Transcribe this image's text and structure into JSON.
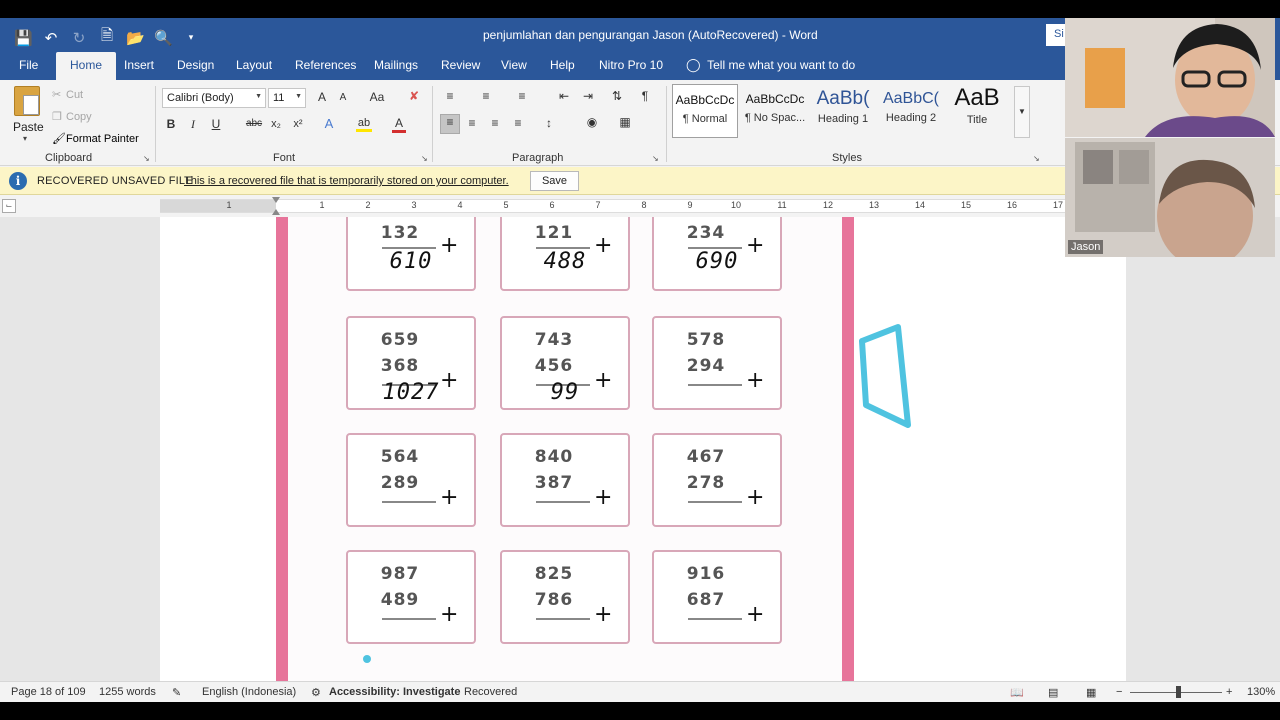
{
  "window": {
    "title": "penjumlahan dan pengurangan Jason (AutoRecovered)  -  Word",
    "signin_label": "Si"
  },
  "tabs": [
    {
      "label": "File"
    },
    {
      "label": "Home",
      "active": true
    },
    {
      "label": "Insert"
    },
    {
      "label": "Design"
    },
    {
      "label": "Layout"
    },
    {
      "label": "References"
    },
    {
      "label": "Mailings"
    },
    {
      "label": "Review"
    },
    {
      "label": "View"
    },
    {
      "label": "Help"
    },
    {
      "label": "Nitro Pro 10"
    }
  ],
  "tell_me": "Tell me what you want to do",
  "clipboard": {
    "paste": "Paste",
    "cut": "Cut",
    "copy": "Copy",
    "format_painter": "Format Painter",
    "group": "Clipboard"
  },
  "font": {
    "family": "Calibri (Body)",
    "size": "11",
    "group": "Font",
    "bold": "B",
    "italic": "I",
    "underline": "U",
    "strike": "abc",
    "subscript": "x₂",
    "superscript": "x²",
    "grow": "A",
    "shrink": "A",
    "change_case": "Aa",
    "effects": "A",
    "highlight": "ab",
    "color": "A"
  },
  "paragraph": {
    "group": "Paragraph"
  },
  "styles": {
    "group": "Styles",
    "items": [
      {
        "sample": "AaBbCcDc",
        "name": "¶ Normal",
        "selected": true
      },
      {
        "sample": "AaBbCcDc",
        "name": "¶ No Spac..."
      },
      {
        "sample": "AaBb(",
        "name": "Heading 1"
      },
      {
        "sample": "AaBbC(",
        "name": "Heading 2"
      },
      {
        "sample": "AaB",
        "name": "Title"
      }
    ]
  },
  "message_bar": {
    "title": "RECOVERED UNSAVED FILE",
    "text": "This is a recovered file that is temporarily stored on your computer.",
    "button": "Save"
  },
  "ruler": {
    "numbers_left": [
      "1"
    ],
    "numbers": [
      "1",
      "2",
      "3",
      "4",
      "5",
      "6",
      "7",
      "8",
      "9",
      "10",
      "11",
      "12",
      "13",
      "14",
      "15",
      "16",
      "17"
    ]
  },
  "worksheet": {
    "problems": [
      {
        "n1": "132",
        "n2": "",
        "op": "+",
        "answer": "610"
      },
      {
        "n1": "121",
        "n2": "",
        "op": "+",
        "answer": "488"
      },
      {
        "n1": "234",
        "n2": "",
        "op": "+",
        "answer": "690"
      },
      {
        "n1": "659",
        "n2": "368",
        "op": "+",
        "answer": "1027"
      },
      {
        "n1": "743",
        "n2": "456",
        "op": "+",
        "answer": "99"
      },
      {
        "n1": "578",
        "n2": "294",
        "op": "+",
        "answer": ""
      },
      {
        "n1": "564",
        "n2": "289",
        "op": "+",
        "answer": ""
      },
      {
        "n1": "840",
        "n2": "387",
        "op": "+",
        "answer": ""
      },
      {
        "n1": "467",
        "n2": "278",
        "op": "+",
        "answer": ""
      },
      {
        "n1": "987",
        "n2": "489",
        "op": "+",
        "answer": ""
      },
      {
        "n1": "825",
        "n2": "786",
        "op": "+",
        "answer": ""
      },
      {
        "n1": "916",
        "n2": "687",
        "op": "+",
        "answer": ""
      }
    ],
    "border_color": "#e7749a",
    "annotation_color": "#4fc3e0"
  },
  "status": {
    "page": "Page 18 of 109",
    "words": "1255 words",
    "language": "English (Indonesia)",
    "accessibility": "Accessibility: Investigate",
    "recovered": "Recovered",
    "zoom": "130%",
    "zoom_minus": "−",
    "zoom_plus": "+"
  },
  "video": {
    "participant_2": "Jason"
  },
  "colors": {
    "ribbon_blue": "#2b579a",
    "message_bar": "#fcf5c7"
  }
}
